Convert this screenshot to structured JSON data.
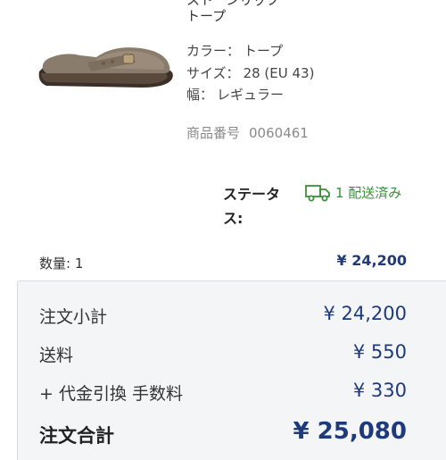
{
  "product": {
    "title_cut": "ストーンリップ",
    "variant": "トープ",
    "image_alt": "clog",
    "attributes": [
      {
        "key": "カラー：",
        "value": "トープ"
      },
      {
        "key": "サイズ：",
        "value": "28 (EU 43)"
      },
      {
        "key": "幅：",
        "value": "レギュラー"
      }
    ],
    "sku_label": "商品番号",
    "sku_value": "0060461"
  },
  "status": {
    "label": "ステータス:",
    "icon": "truck-icon",
    "text": "1 配送済み"
  },
  "line": {
    "quantity": "数量: 1",
    "price": "¥ 24,200"
  },
  "summary": {
    "subtotal_label": "注文小計",
    "subtotal_value": "¥ 24,200",
    "shipping_label": "送料",
    "shipping_value": "¥ 550",
    "cod_label": "+ 代金引換 手数料",
    "cod_value": "¥ 330",
    "total_label": "注文合計",
    "total_value": "¥ 25,080"
  },
  "colors": {
    "accent_blue": "#1f3a7a",
    "status_green": "#3a8f3a",
    "panel_bg": "#f4f5f7"
  }
}
